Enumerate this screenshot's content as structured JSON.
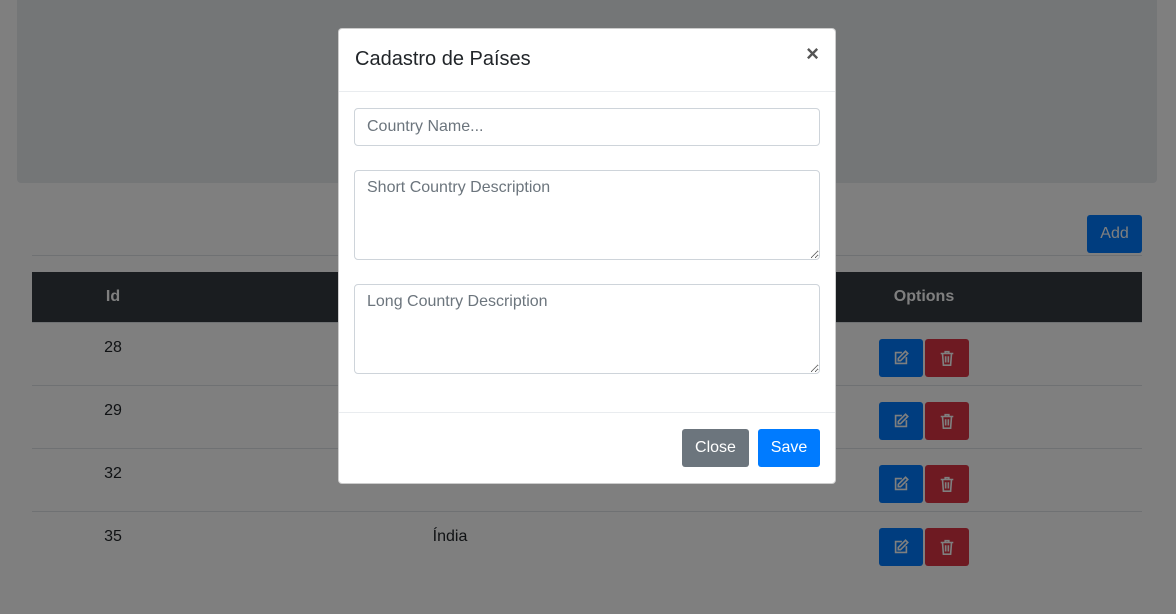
{
  "page": {
    "add_label": "Add",
    "table": {
      "headers": {
        "id": "Id",
        "name": "",
        "options": "Options"
      },
      "rows": [
        {
          "id": "28",
          "name": ""
        },
        {
          "id": "29",
          "name": ""
        },
        {
          "id": "32",
          "name": ""
        },
        {
          "id": "35",
          "name": "Índia"
        }
      ]
    },
    "colors": {
      "primary": "#007bff",
      "danger": "#dc3545",
      "secondary": "#6c757d",
      "table_header": "#343a40"
    }
  },
  "modal": {
    "title": "Cadastro de Países",
    "close_symbol": "×",
    "fields": {
      "name_placeholder": "Country Name...",
      "short_desc_placeholder": "Short Country Description",
      "long_desc_placeholder": "Long Country Description"
    },
    "buttons": {
      "close_label": "Close",
      "save_label": "Save"
    }
  },
  "icons": {
    "edit": "edit-icon",
    "delete": "trash-icon"
  }
}
